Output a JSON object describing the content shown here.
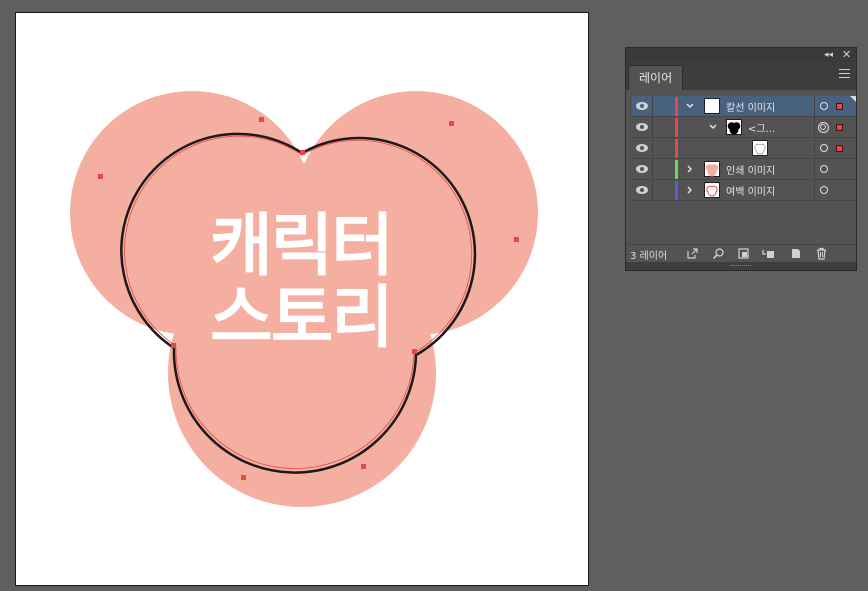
{
  "artboard": {
    "title_line1": "캐릭터",
    "title_line2": "스토리",
    "fill_color": "#f5afa0",
    "stroke_color": "#1a1a1a",
    "anchor_color": "#e8464a"
  },
  "layers_panel": {
    "collapse_icon": "double-chevron-left-icon",
    "close_icon": "close-icon",
    "tab_label": "레이어",
    "menu_icon": "hamburger-menu-icon",
    "rows": [
      {
        "label": "칼선 이미지",
        "color": "#e8464a",
        "expanded": true,
        "selected": true
      },
      {
        "label": "<그...",
        "color": "#e8464a",
        "expanded": true,
        "selected": false
      },
      {
        "label": "",
        "color": "#e8464a",
        "expanded": false,
        "selected": false
      },
      {
        "label": "인쇄 이미지",
        "color": "#5fdc5f",
        "expanded": false,
        "selected": false
      },
      {
        "label": "여백 이미지",
        "color": "#5b5bdc",
        "expanded": false,
        "selected": false
      }
    ],
    "footer": {
      "count_label": "3 레이어",
      "icons": [
        "export-icon",
        "search-icon",
        "clipping-mask-icon",
        "new-sublayer-icon",
        "new-layer-icon",
        "trash-icon"
      ]
    }
  }
}
